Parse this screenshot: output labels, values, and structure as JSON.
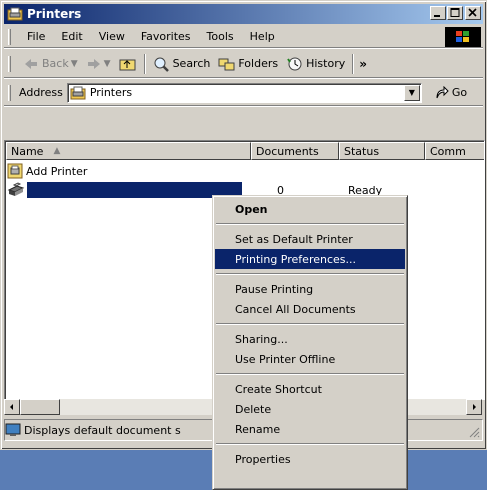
{
  "window": {
    "title": "Printers"
  },
  "menu": [
    "File",
    "Edit",
    "View",
    "Favorites",
    "Tools",
    "Help"
  ],
  "toolbar": {
    "back": "Back",
    "search": "Search",
    "folders": "Folders",
    "history": "History",
    "more": "»"
  },
  "address": {
    "label": "Address",
    "value": "Printers",
    "go": "Go"
  },
  "columns": [
    "Name",
    "Documents",
    "Status",
    "Comm"
  ],
  "rows": [
    {
      "name": "Add Printer",
      "documents": "",
      "status": ""
    },
    {
      "name": "",
      "documents": "0",
      "status": "Ready"
    }
  ],
  "status_bar": {
    "text": "Displays default document s"
  },
  "context_menu": {
    "open": "Open",
    "set_default": "Set as Default Printer",
    "preferences": "Printing Preferences...",
    "pause": "Pause Printing",
    "cancel_all": "Cancel All Documents",
    "sharing": "Sharing...",
    "offline": "Use Printer Offline",
    "shortcut": "Create Shortcut",
    "delete": "Delete",
    "rename": "Rename",
    "properties": "Properties"
  },
  "colors": {
    "title_active": "#0a246a",
    "face": "#d4d0c8",
    "highlight": "#0a246a",
    "desktop": "#5a7db5"
  }
}
